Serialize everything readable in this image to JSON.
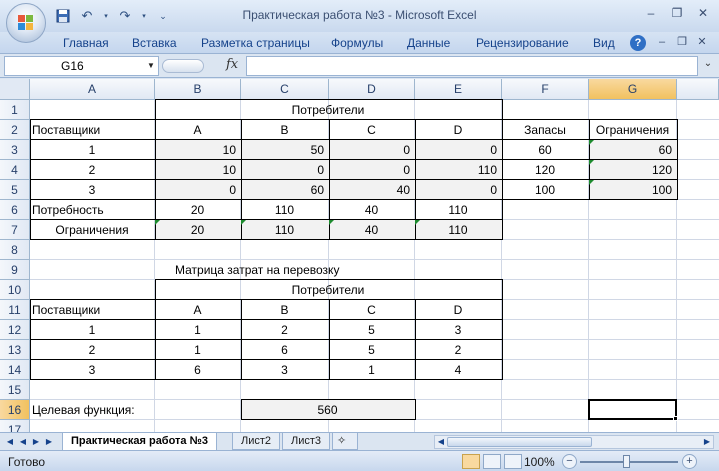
{
  "window": {
    "title": "Практическая работа №3 - Microsoft Excel"
  },
  "qat": {
    "save_icon": "save-icon",
    "undo_icon": "undo-icon",
    "redo_icon": "redo-icon"
  },
  "ribbon": {
    "tabs": [
      "Главная",
      "Вставка",
      "Разметка страницы",
      "Формулы",
      "Данные",
      "Рецензирование",
      "Вид"
    ],
    "help": "?"
  },
  "formula_bar": {
    "name_box": "G16",
    "fx": "fx",
    "formula": ""
  },
  "columns": [
    "A",
    "B",
    "C",
    "D",
    "E",
    "F",
    "G"
  ],
  "rows": [
    "1",
    "2",
    "3",
    "4",
    "5",
    "6",
    "7",
    "8",
    "9",
    "10",
    "11",
    "12",
    "13",
    "14",
    "15",
    "16",
    "17"
  ],
  "selected_cell": "G16",
  "cells": {
    "header_consumers": "Потребители",
    "r2": {
      "a": "Поставщики",
      "b": "A",
      "c": "B",
      "d": "C",
      "e": "D",
      "f": "Запасы",
      "g": "Ограничения"
    },
    "r3": {
      "a": "1",
      "b": "10",
      "c": "50",
      "d": "0",
      "e": "0",
      "f": "60",
      "g": "60"
    },
    "r4": {
      "a": "2",
      "b": "10",
      "c": "0",
      "d": "0",
      "e": "110",
      "f": "120",
      "g": "120"
    },
    "r5": {
      "a": "3",
      "b": "0",
      "c": "60",
      "d": "40",
      "e": "0",
      "f": "100",
      "g": "100"
    },
    "r6": {
      "a": "Потребность",
      "b": "20",
      "c": "110",
      "d": "40",
      "e": "110"
    },
    "r7": {
      "a": "Ограничения",
      "b": "20",
      "c": "110",
      "d": "40",
      "e": "110"
    },
    "r9_title": "Матрица затрат на перевозку",
    "r10_consumers": "Потребители",
    "r11": {
      "a": "Поставщики",
      "b": "A",
      "c": "B",
      "d": "C",
      "e": "D"
    },
    "r12": {
      "a": "1",
      "b": "1",
      "c": "2",
      "d": "5",
      "e": "3"
    },
    "r13": {
      "a": "2",
      "b": "1",
      "c": "6",
      "d": "5",
      "e": "2"
    },
    "r14": {
      "a": "3",
      "b": "6",
      "c": "3",
      "d": "1",
      "e": "4"
    },
    "r16": {
      "label": "Целевая функция:",
      "value": "560"
    }
  },
  "sheet_tabs": [
    "Практическая работа №3",
    "Лист2",
    "Лист3"
  ],
  "active_sheet": "Практическая работа №3",
  "status": {
    "ready": "Готово",
    "zoom": "100%"
  },
  "colors": {
    "shade": "#f2f2f2",
    "selection_header": "#f1c15f",
    "error_triangle": "#1e8c2f"
  }
}
